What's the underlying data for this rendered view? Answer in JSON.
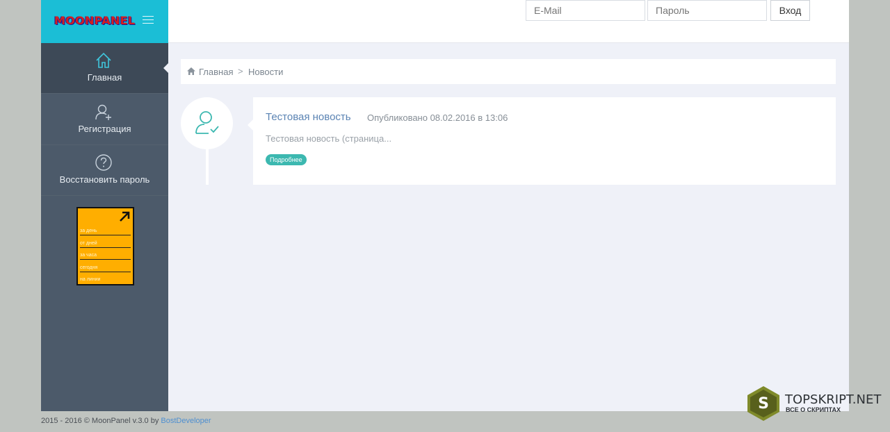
{
  "brand": {
    "logo_text": "MOONPANEL"
  },
  "topbar": {
    "email_placeholder": "E-Mail",
    "password_placeholder": "Пароль",
    "login_label": "Вход"
  },
  "sidebar": {
    "items": [
      {
        "label": "Главная",
        "icon": "home-icon"
      },
      {
        "label": "Регистрация",
        "icon": "add-user-icon"
      },
      {
        "label": "Восстановить пароль",
        "icon": "question-icon"
      }
    ],
    "banner": {
      "lines": [
        "за день",
        "от дней",
        "за часа",
        "сегодня",
        "на линии"
      ]
    }
  },
  "breadcrumb": {
    "home": "Главная",
    "separator": ">",
    "current": "Новости"
  },
  "news": {
    "title": "Тестовая новость",
    "date": "Опубликовано 08.02.2016 в 13:06",
    "excerpt": "Тестовая новость (страница...",
    "more_label": "Подробнее"
  },
  "footer": {
    "text": "2015 - 2016 © MoonPanel v.3.0 by ",
    "link": "BostDeveloper"
  },
  "watermark": {
    "title": "TOPSKRIPT.NET",
    "subtitle": "ВСЕ О СКРИПТАХ",
    "hex_letter": "S"
  },
  "colors": {
    "accent": "#1bbed6",
    "sidebar": "#4c5a6a",
    "teal": "#3cb8b0",
    "link": "#5a83b3",
    "banner": "#ffae00"
  }
}
